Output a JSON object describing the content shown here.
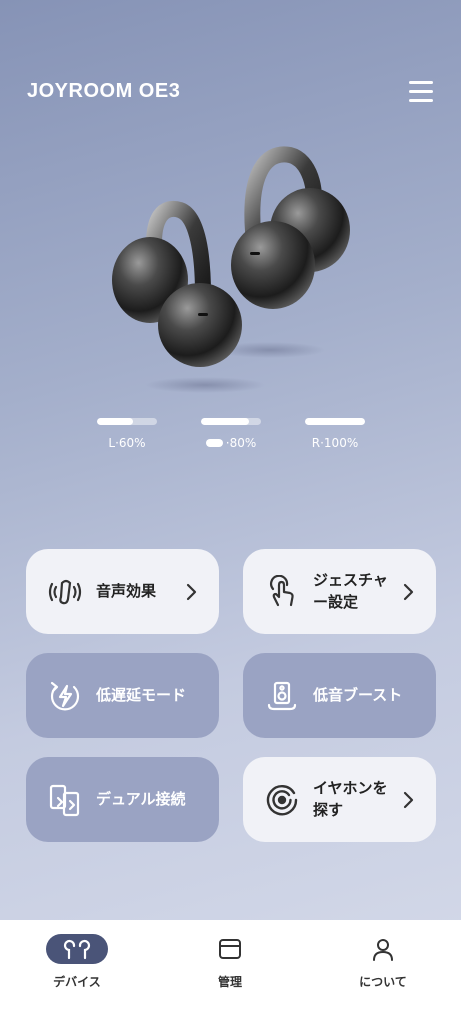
{
  "header": {
    "device_name": "JOYROOM OE3",
    "menu_icon": "hamburger-menu-icon"
  },
  "battery": [
    {
      "label": "L·60%",
      "level": 0.6
    },
    {
      "label": "·80%",
      "level": 0.8,
      "icon": "charging-case-icon"
    },
    {
      "label": "R·100%",
      "level": 1.0
    }
  ],
  "features": {
    "sound_effects": {
      "label": "音声効果",
      "icon": "sound-effects-icon"
    },
    "gesture_settings": {
      "line1": "ジェスチャ",
      "line2": "ー設定",
      "icon": "touch-gesture-icon"
    },
    "low_latency": {
      "label": "低遅延モード",
      "icon": "lightning-icon"
    },
    "bass_boost": {
      "label": "低音ブースト",
      "icon": "speaker-icon"
    },
    "dual_connect": {
      "label": "デュアル接続",
      "icon": "dual-phone-icon"
    },
    "find_earbuds": {
      "line1": "イヤホンを",
      "line2": "探す",
      "icon": "radar-icon"
    }
  },
  "tabs": [
    {
      "label": "デバイス",
      "icon": "earbuds-icon",
      "active": true
    },
    {
      "label": "管理",
      "icon": "window-icon",
      "active": false
    },
    {
      "label": "について",
      "icon": "person-icon",
      "active": false
    }
  ],
  "colors": {
    "background_top": "#8693b6",
    "background_bottom": "#d6dbea",
    "card_light": "#f1f2f7",
    "card_dark": "#9aa3c3",
    "active_tab_pill": "#4a5478"
  }
}
